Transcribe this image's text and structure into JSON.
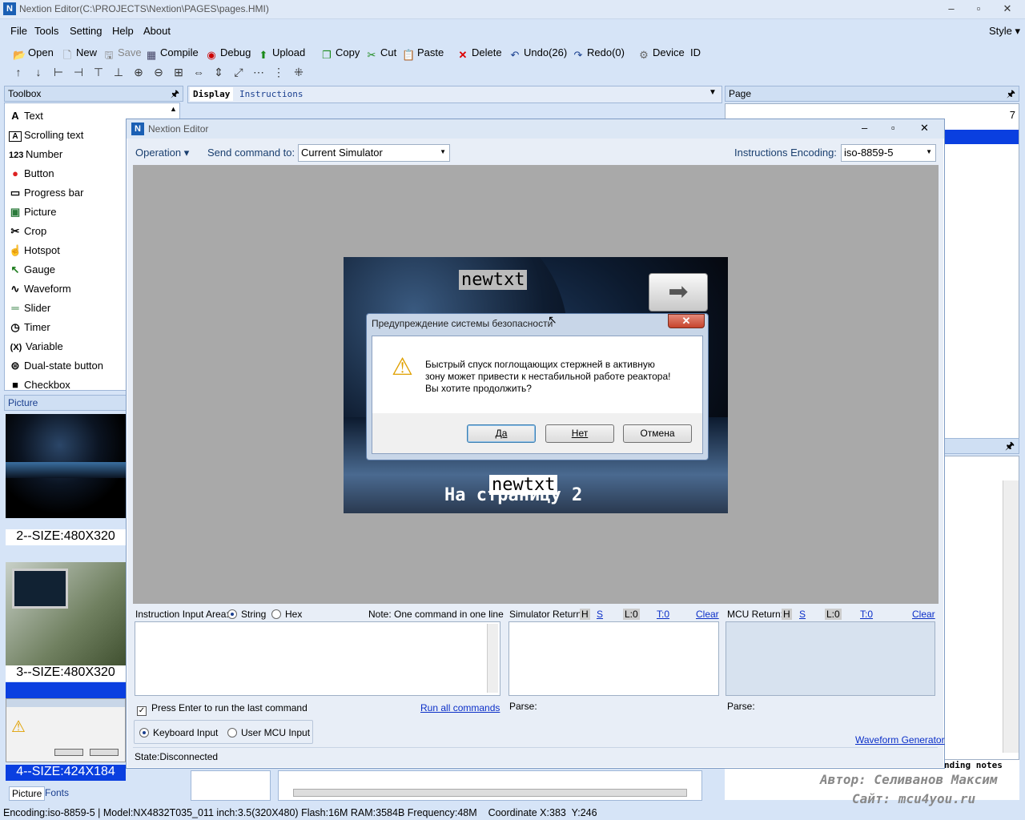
{
  "window": {
    "title": "Nextion Editor(C:\\PROJECTS\\Nextion\\PAGES\\pages.HMI)",
    "logo": "N"
  },
  "menu": [
    "File",
    "Tools",
    "Setting",
    "Help",
    "About"
  ],
  "style_menu": "Style",
  "toolbar": [
    "Open",
    "New",
    "Save",
    "Compile",
    "Debug",
    "Upload",
    "Copy",
    "Cut",
    "Paste",
    "Delete",
    "Undo(26)",
    "Redo(0)",
    "Device  ID"
  ],
  "toolbox": {
    "title": "Toolbox",
    "items": [
      {
        "icon": "A",
        "label": "Text"
      },
      {
        "icon": "A",
        "label": "Scrolling text"
      },
      {
        "icon": "123",
        "label": "Number"
      },
      {
        "icon": "●",
        "label": "Button"
      },
      {
        "icon": "▭",
        "label": "Progress bar"
      },
      {
        "icon": "▣",
        "label": "Picture"
      },
      {
        "icon": "✂",
        "label": "Crop"
      },
      {
        "icon": "☝",
        "label": "Hotspot"
      },
      {
        "icon": "↖",
        "label": "Gauge"
      },
      {
        "icon": "∿",
        "label": "Waveform"
      },
      {
        "icon": "═",
        "label": "Slider"
      },
      {
        "icon": "◷",
        "label": "Timer"
      },
      {
        "icon": "(X)",
        "label": "Variable"
      },
      {
        "icon": "⊜",
        "label": "Dual-state button"
      },
      {
        "icon": "■",
        "label": "Checkbox"
      }
    ]
  },
  "picture_panel": {
    "title": "Picture",
    "thumbs": [
      "2--SIZE:480X320",
      "3--SIZE:480X320",
      "4--SIZE:424X184"
    ],
    "tabs": [
      "Picture",
      "Fonts"
    ]
  },
  "editor_tabs": [
    "Display",
    "Instructions"
  ],
  "page_panel": {
    "title": "Page",
    "count": "7"
  },
  "dialog": {
    "title": "Nextion Editor",
    "operation": "Operation",
    "send_label": "Send command to:",
    "send_value": "Current Simulator",
    "encoding_label": "Instructions Encoding:",
    "encoding_value": "iso-8859-5"
  },
  "screen": {
    "text_top": "newtxt",
    "text_bottom": "newtxt",
    "page_text": "На страницу 2"
  },
  "msgbox": {
    "title": "Предупреждение системы безопасности",
    "line1": "Быстрый спуск поглощающих стержней в активную",
    "line2": "зону может привести к нестабильной работе реактора!",
    "line3": "Вы хотите продолжить?",
    "btn_yes": "Да",
    "btn_no": "Нет",
    "btn_cancel": "Отмена"
  },
  "input_area": {
    "label": "Instruction Input Area:",
    "string": "String",
    "hex": "Hex",
    "note": "Note: One command in one line",
    "press_enter": "Press Enter to run the last command",
    "run_all": "Run all commands",
    "keyboard": "Keyboard Input",
    "user_mcu": "User MCU Input",
    "state": "State:Disconnected"
  },
  "sim_return": {
    "label": "Simulator Return:",
    "h": "H",
    "s": "S",
    "l": "L:0",
    "t": "T:0",
    "clear": "Clear",
    "parse": "Parse:"
  },
  "mcu_return": {
    "label": "MCU Return:",
    "h": "H",
    "s": "S",
    "l": "L:0",
    "t": "T:0",
    "clear": "Clear",
    "parse": "Parse:"
  },
  "waveform_gen": "Waveform Generator",
  "watermark": {
    "partial": "nding notes",
    "author": "Автор: Селиванов Максим",
    "site": "Сайт: mcu4you.ru"
  },
  "status": {
    "encoding": "Encoding:iso-8859-5",
    "model": "Model:NX4832T035_011",
    "inch": "inch:3.5(320X480)",
    "flash": "Flash:16M",
    "ram": "RAM:3584B",
    "freq": "Frequency:48M",
    "coord": "Coordinate X:383  Y:246"
  }
}
